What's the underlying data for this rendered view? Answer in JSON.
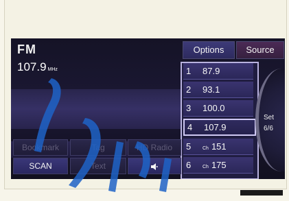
{
  "radio": {
    "band": "FM",
    "frequency": "107.9",
    "frequency_unit": "MHz"
  },
  "top_buttons": {
    "options": "Options",
    "source": "Source"
  },
  "presets": [
    {
      "num": "1",
      "value": "87.9",
      "prefix": ""
    },
    {
      "num": "2",
      "value": "93.1",
      "prefix": ""
    },
    {
      "num": "3",
      "value": "100.0",
      "prefix": ""
    },
    {
      "num": "4",
      "value": "107.9",
      "prefix": ""
    },
    {
      "num": "5",
      "value": "151",
      "prefix": "Ch"
    },
    {
      "num": "6",
      "value": "175",
      "prefix": "Ch"
    }
  ],
  "selected_preset": "4",
  "set_dial": {
    "label": "Set",
    "count": "6/6"
  },
  "bottom_buttons": {
    "bookmark": "Bookmark",
    "tag": "Tag",
    "hd_radio": "HD Radio",
    "scan": "SCAN",
    "text": "Text",
    "speaker_icon": "speaker-icon"
  },
  "colors": {
    "screen_bg": "#151326",
    "preset_bg": "#3a3470",
    "options_bg": "#3d3a78",
    "source_bg": "#4b2a55",
    "watermark": "#1f63c7"
  }
}
